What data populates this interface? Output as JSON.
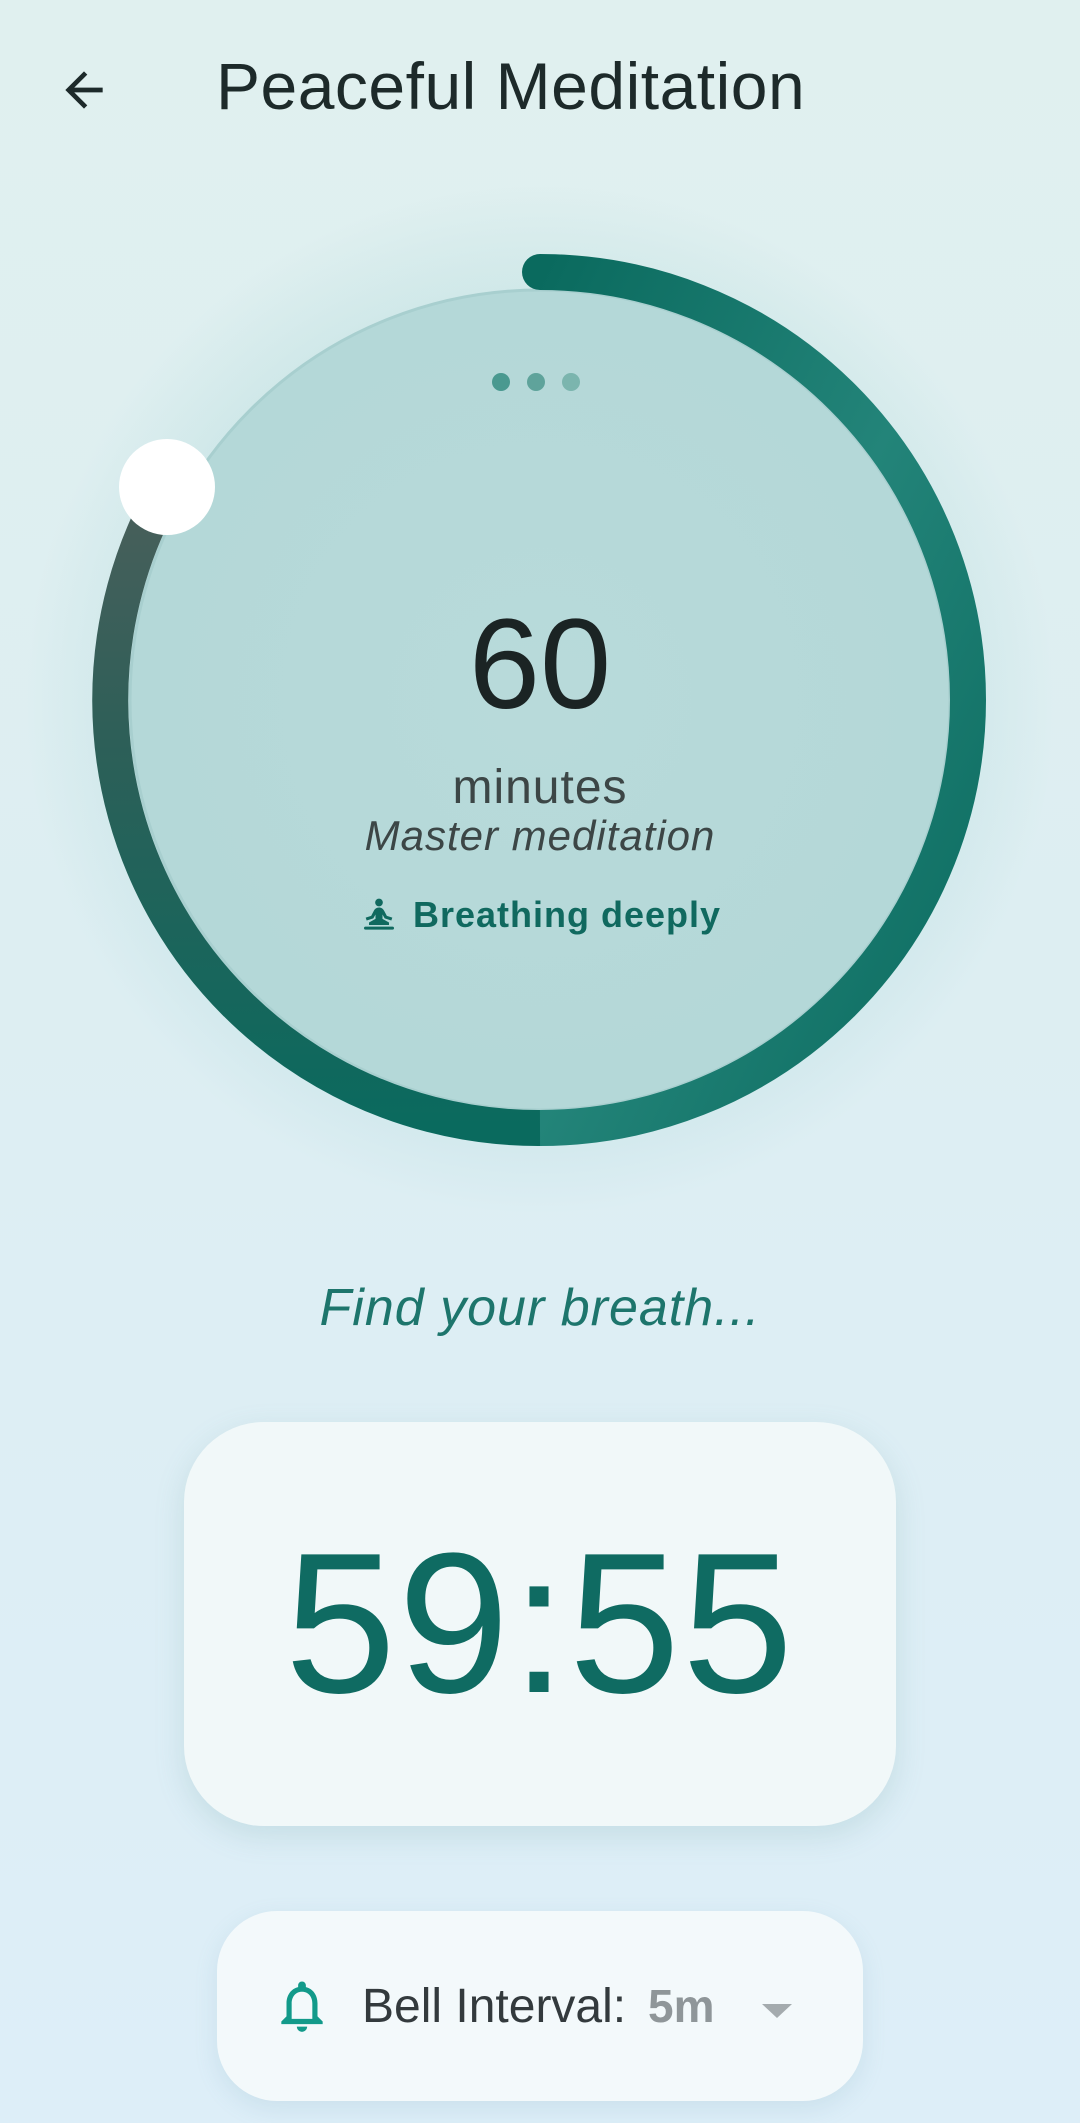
{
  "app_bar": {
    "title": "Peaceful Meditation",
    "back_icon": "arrow-back-icon"
  },
  "dial": {
    "duration_value": "60",
    "duration_unit": "minutes",
    "level_label": "Master meditation",
    "status_text": "Breathing deeply",
    "status_icon": "meditation-pose-icon",
    "page_dots": 3,
    "track_color": "#0f6b62",
    "handle_color": "#ffffff"
  },
  "prompt": {
    "text": "Find your breath..."
  },
  "timer": {
    "remaining": "59:55"
  },
  "bell": {
    "icon": "bell-icon",
    "label": "Bell Interval:",
    "value": "5m",
    "dropdown_icon": "dropdown-arrow-icon"
  },
  "colors": {
    "accent": "#0f6b62",
    "accent_light": "#2a8f84",
    "text_dark": "#1b2424",
    "muted": "#8f9699"
  }
}
